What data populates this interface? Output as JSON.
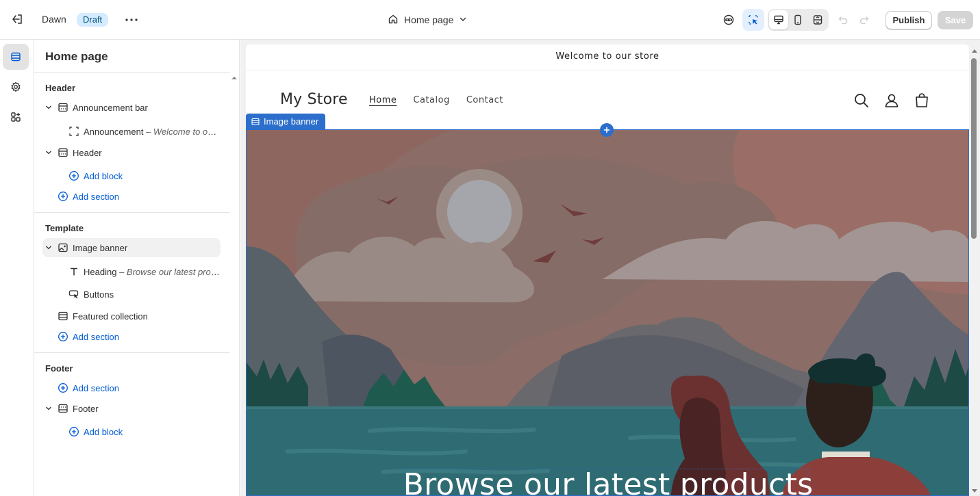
{
  "topbar": {
    "theme_name": "Dawn",
    "theme_status": "Draft",
    "page_selector": "Home page",
    "publish_label": "Publish",
    "save_label": "Save",
    "icons": [
      "exit-icon",
      "more-icon",
      "home-icon",
      "chevron-down-icon",
      "inspector-icon",
      "select-cursor-icon",
      "desktop-icon",
      "mobile-icon",
      "fullscreen-icon",
      "undo-icon",
      "redo-icon"
    ]
  },
  "rail": {
    "items": [
      {
        "name": "sections",
        "icon": "sections-icon",
        "active": true
      },
      {
        "name": "theme-settings",
        "icon": "gear-icon",
        "active": false
      },
      {
        "name": "app-embeds",
        "icon": "apps-icon",
        "active": false
      }
    ]
  },
  "sidebar": {
    "title": "Home page",
    "groups": {
      "header": {
        "label": "Header",
        "announcement_bar": "Announcement bar",
        "announcement_block": "Announcement",
        "announcement_block_detail": "Welcome to our store",
        "header_section": "Header",
        "add_block": "Add block",
        "add_section": "Add section"
      },
      "template": {
        "label": "Template",
        "image_banner": "Image banner",
        "heading_block": "Heading",
        "heading_block_detail": "Browse our latest products",
        "buttons_block": "Buttons",
        "featured_collection": "Featured collection",
        "add_section": "Add section"
      },
      "footer": {
        "label": "Footer",
        "add_section": "Add section",
        "footer_section": "Footer",
        "add_block": "Add block"
      }
    }
  },
  "preview": {
    "announcement_text": "Welcome to our store",
    "store_name": "My Store",
    "nav": [
      "Home",
      "Catalog",
      "Contact"
    ],
    "nav_current": "Home",
    "selected_section_tag": "Image banner",
    "banner_heading": "Browse our latest products",
    "header_icons": [
      "search-icon",
      "account-icon",
      "cart-icon"
    ]
  },
  "colors": {
    "accent": "#2c6ecb",
    "link": "#005bd3",
    "draft_badge_bg": "#d5ebff",
    "draft_badge_text": "#00527c",
    "sky": "#8a6c66",
    "water": "#2f6b72"
  }
}
